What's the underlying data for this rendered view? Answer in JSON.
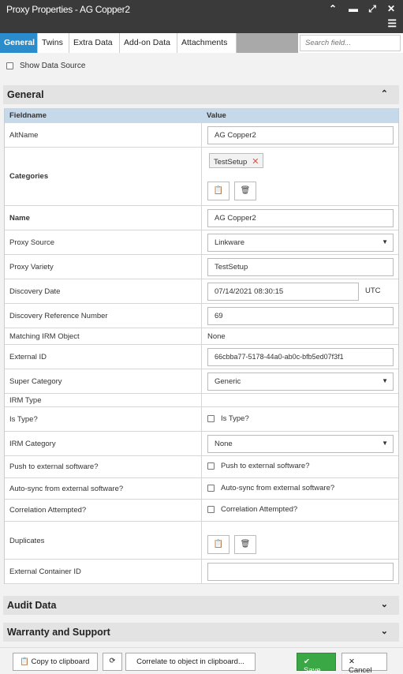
{
  "window": {
    "title": "Proxy Properties - AG Copper2"
  },
  "tabs": [
    "General",
    "Twins",
    "Extra Data",
    "Add-on Data",
    "Attachments"
  ],
  "search": {
    "placeholder": "Search field..."
  },
  "show_data_source": "Show Data Source",
  "sections": {
    "general": "General",
    "audit": "Audit Data",
    "warranty": "Warranty and Support"
  },
  "grid": {
    "header_field": "Fieldname",
    "header_value": "Value",
    "altname": {
      "label": "AltName",
      "value": "AG Copper2"
    },
    "categories": {
      "label": "Categories",
      "chip": "TestSetup"
    },
    "name": {
      "label": "Name",
      "value": "AG Copper2"
    },
    "proxy_source": {
      "label": "Proxy Source",
      "value": "Linkware"
    },
    "proxy_variety": {
      "label": "Proxy Variety",
      "value": "TestSetup"
    },
    "discovery_date": {
      "label": "Discovery Date",
      "value": "07/14/2021 08:30:15",
      "tz": "UTC"
    },
    "discovery_ref": {
      "label": "Discovery Reference Number",
      "value": "69"
    },
    "matching_irm": {
      "label": "Matching IRM Object",
      "value": "None"
    },
    "external_id": {
      "label": "External ID",
      "value": "66cbba77-5178-44a0-ab0c-bfb5ed07f3f1"
    },
    "super_category": {
      "label": "Super Category",
      "value": "Generic"
    },
    "irm_type": {
      "label": "IRM Type"
    },
    "is_type": {
      "label": "Is Type?",
      "check": "Is Type?"
    },
    "irm_category": {
      "label": "IRM Category",
      "value": "None"
    },
    "push_external": {
      "label": "Push to external software?",
      "check": "Push to external software?"
    },
    "autosync": {
      "label": "Auto-sync from external software?",
      "check": "Auto-sync from external software?"
    },
    "correlation": {
      "label": "Correlation Attempted?",
      "check": "Correlation Attempted?"
    },
    "duplicates": {
      "label": "Duplicates"
    },
    "ext_container": {
      "label": "External Container ID",
      "value": ""
    }
  },
  "footer": {
    "copy": "Copy to clipboard",
    "correlate": "Correlate to object in clipboard...",
    "save": "Save",
    "cancel": "Cancel"
  }
}
